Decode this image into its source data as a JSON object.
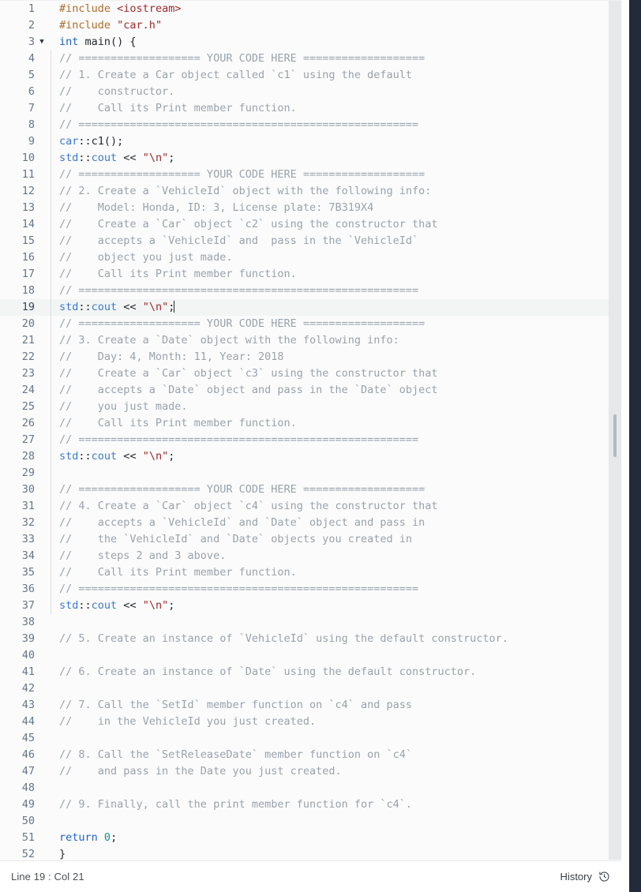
{
  "editor": {
    "language": "cpp",
    "cursor_line": 19,
    "cursor_col": 21,
    "active_line": 19,
    "fold_line": 3,
    "fold_marker": "▼",
    "colors": {
      "background": "#fbfbfb",
      "active_line": "#f2f5f4",
      "gutter_text": "#68758a",
      "comment": "#9aa2ac",
      "keyword": "#1d63c7",
      "namespace": "#3b7ad1",
      "string": "#a0282b",
      "preprocessor": "#b06c28",
      "number": "#12918a",
      "right_rail": "#222a3b",
      "scrollbar_track": "#e6e8ea",
      "scrollbar_thumb": "#b6b9bd"
    },
    "lines": [
      {
        "n": 1,
        "guide": false,
        "tokens": [
          {
            "t": "#include",
            "c": "t-pre"
          },
          {
            "t": " ",
            "c": "t-punc"
          },
          {
            "t": "<iostream>",
            "c": "t-str"
          }
        ]
      },
      {
        "n": 2,
        "guide": false,
        "tokens": [
          {
            "t": "#include",
            "c": "t-pre"
          },
          {
            "t": " ",
            "c": "t-punc"
          },
          {
            "t": "\"car.h\"",
            "c": "t-str"
          }
        ]
      },
      {
        "n": 3,
        "guide": false,
        "fold": true,
        "tokens": [
          {
            "t": "int",
            "c": "t-kw"
          },
          {
            "t": " ",
            "c": "t-punc"
          },
          {
            "t": "main",
            "c": "t-fn"
          },
          {
            "t": "() {",
            "c": "t-punc"
          }
        ]
      },
      {
        "n": 4,
        "guide": true,
        "tokens": [
          {
            "t": "// =================== YOUR CODE HERE ===================",
            "c": "t-cmt"
          }
        ]
      },
      {
        "n": 5,
        "guide": true,
        "tokens": [
          {
            "t": "// 1. Create a Car object called `c1` using the default",
            "c": "t-cmt"
          }
        ]
      },
      {
        "n": 6,
        "guide": true,
        "tokens": [
          {
            "t": "//    constructor.",
            "c": "t-cmt"
          }
        ]
      },
      {
        "n": 7,
        "guide": true,
        "tokens": [
          {
            "t": "//    Call its Print member function.",
            "c": "t-cmt"
          }
        ]
      },
      {
        "n": 8,
        "guide": true,
        "tokens": [
          {
            "t": "// =====================================================",
            "c": "t-cmt"
          }
        ]
      },
      {
        "n": 9,
        "guide": true,
        "tokens": [
          {
            "t": "car",
            "c": "t-ns"
          },
          {
            "t": "::c1();",
            "c": "t-punc"
          }
        ]
      },
      {
        "n": 10,
        "guide": true,
        "tokens": [
          {
            "t": "std",
            "c": "t-ns"
          },
          {
            "t": "::",
            "c": "t-punc"
          },
          {
            "t": "cout",
            "c": "t-ns"
          },
          {
            "t": " << ",
            "c": "t-punc"
          },
          {
            "t": "\"\\n\"",
            "c": "t-str"
          },
          {
            "t": ";",
            "c": "t-punc"
          }
        ]
      },
      {
        "n": 11,
        "guide": true,
        "tokens": [
          {
            "t": "// =================== YOUR CODE HERE ===================",
            "c": "t-cmt"
          }
        ]
      },
      {
        "n": 12,
        "guide": true,
        "tokens": [
          {
            "t": "// 2. Create a `VehicleId` object with the following info:",
            "c": "t-cmt"
          }
        ]
      },
      {
        "n": 13,
        "guide": true,
        "tokens": [
          {
            "t": "//    Model: Honda, ID: 3, License plate: 7B319X4",
            "c": "t-cmt"
          }
        ]
      },
      {
        "n": 14,
        "guide": true,
        "tokens": [
          {
            "t": "//    Create a `Car` object `c2` using the constructor that",
            "c": "t-cmt"
          }
        ]
      },
      {
        "n": 15,
        "guide": true,
        "tokens": [
          {
            "t": "//    accepts a `VehicleId` and  pass in the `VehicleId`",
            "c": "t-cmt"
          }
        ]
      },
      {
        "n": 16,
        "guide": true,
        "tokens": [
          {
            "t": "//    object you just made.",
            "c": "t-cmt"
          }
        ]
      },
      {
        "n": 17,
        "guide": true,
        "tokens": [
          {
            "t": "//    Call its Print member function.",
            "c": "t-cmt"
          }
        ]
      },
      {
        "n": 18,
        "guide": true,
        "tokens": [
          {
            "t": "// =====================================================",
            "c": "t-cmt"
          }
        ]
      },
      {
        "n": 19,
        "guide": true,
        "active": true,
        "caret": true,
        "tokens": [
          {
            "t": "std",
            "c": "t-ns"
          },
          {
            "t": "::",
            "c": "t-punc"
          },
          {
            "t": "cout",
            "c": "t-ns"
          },
          {
            "t": " << ",
            "c": "t-punc"
          },
          {
            "t": "\"\\n\"",
            "c": "t-str"
          },
          {
            "t": ";",
            "c": "t-punc"
          }
        ]
      },
      {
        "n": 20,
        "guide": true,
        "tokens": [
          {
            "t": "// =================== YOUR CODE HERE ===================",
            "c": "t-cmt"
          }
        ]
      },
      {
        "n": 21,
        "guide": true,
        "tokens": [
          {
            "t": "// 3. Create a `Date` object with the following info:",
            "c": "t-cmt"
          }
        ]
      },
      {
        "n": 22,
        "guide": true,
        "tokens": [
          {
            "t": "//    Day: 4, Month: 11, Year: 2018",
            "c": "t-cmt"
          }
        ]
      },
      {
        "n": 23,
        "guide": true,
        "tokens": [
          {
            "t": "//    Create a `Car` object `c3` using the constructor that",
            "c": "t-cmt"
          }
        ]
      },
      {
        "n": 24,
        "guide": true,
        "tokens": [
          {
            "t": "//    accepts a `Date` object and pass in the `Date` object",
            "c": "t-cmt"
          }
        ]
      },
      {
        "n": 25,
        "guide": true,
        "tokens": [
          {
            "t": "//    you just made.",
            "c": "t-cmt"
          }
        ]
      },
      {
        "n": 26,
        "guide": true,
        "tokens": [
          {
            "t": "//    Call its Print member function.",
            "c": "t-cmt"
          }
        ]
      },
      {
        "n": 27,
        "guide": true,
        "tokens": [
          {
            "t": "// =====================================================",
            "c": "t-cmt"
          }
        ]
      },
      {
        "n": 28,
        "guide": true,
        "tokens": [
          {
            "t": "std",
            "c": "t-ns"
          },
          {
            "t": "::",
            "c": "t-punc"
          },
          {
            "t": "cout",
            "c": "t-ns"
          },
          {
            "t": " << ",
            "c": "t-punc"
          },
          {
            "t": "\"\\n\"",
            "c": "t-str"
          },
          {
            "t": ";",
            "c": "t-punc"
          }
        ]
      },
      {
        "n": 29,
        "guide": true,
        "tokens": []
      },
      {
        "n": 30,
        "guide": true,
        "tokens": [
          {
            "t": "// =================== YOUR CODE HERE ===================",
            "c": "t-cmt"
          }
        ]
      },
      {
        "n": 31,
        "guide": true,
        "tokens": [
          {
            "t": "// 4. Create a `Car` object `c4` using the constructor that",
            "c": "t-cmt"
          }
        ]
      },
      {
        "n": 32,
        "guide": true,
        "tokens": [
          {
            "t": "//    accepts a `VehicleId` and `Date` object and pass in",
            "c": "t-cmt"
          }
        ]
      },
      {
        "n": 33,
        "guide": true,
        "tokens": [
          {
            "t": "//    the `VehicleId` and `Date` objects you created in",
            "c": "t-cmt"
          }
        ]
      },
      {
        "n": 34,
        "guide": true,
        "tokens": [
          {
            "t": "//    steps 2 and 3 above.",
            "c": "t-cmt"
          }
        ]
      },
      {
        "n": 35,
        "guide": true,
        "tokens": [
          {
            "t": "//    Call its Print member function.",
            "c": "t-cmt"
          }
        ]
      },
      {
        "n": 36,
        "guide": true,
        "tokens": [
          {
            "t": "// =====================================================",
            "c": "t-cmt"
          }
        ]
      },
      {
        "n": 37,
        "guide": true,
        "tokens": [
          {
            "t": "std",
            "c": "t-ns"
          },
          {
            "t": "::",
            "c": "t-punc"
          },
          {
            "t": "cout",
            "c": "t-ns"
          },
          {
            "t": " << ",
            "c": "t-punc"
          },
          {
            "t": "\"\\n\"",
            "c": "t-str"
          },
          {
            "t": ";",
            "c": "t-punc"
          }
        ]
      },
      {
        "n": 38,
        "guide": false,
        "tokens": []
      },
      {
        "n": 39,
        "guide": false,
        "tokens": [
          {
            "t": "// 5. Create an instance of `VehicleId` using the default constructor.",
            "c": "t-cmt"
          }
        ]
      },
      {
        "n": 40,
        "guide": false,
        "tokens": []
      },
      {
        "n": 41,
        "guide": false,
        "tokens": [
          {
            "t": "// 6. Create an instance of `Date` using the default constructor.",
            "c": "t-cmt"
          }
        ]
      },
      {
        "n": 42,
        "guide": false,
        "tokens": []
      },
      {
        "n": 43,
        "guide": false,
        "tokens": [
          {
            "t": "// 7. Call the `SetId` member function on `c4` and pass",
            "c": "t-cmt"
          }
        ]
      },
      {
        "n": 44,
        "guide": false,
        "tokens": [
          {
            "t": "//    in the VehicleId you just created.",
            "c": "t-cmt"
          }
        ]
      },
      {
        "n": 45,
        "guide": false,
        "tokens": []
      },
      {
        "n": 46,
        "guide": false,
        "tokens": [
          {
            "t": "// 8. Call the `SetReleaseDate` member function on `c4`",
            "c": "t-cmt"
          }
        ]
      },
      {
        "n": 47,
        "guide": false,
        "tokens": [
          {
            "t": "//    and pass in the Date you just created.",
            "c": "t-cmt"
          }
        ]
      },
      {
        "n": 48,
        "guide": false,
        "tokens": []
      },
      {
        "n": 49,
        "guide": false,
        "tokens": [
          {
            "t": "// 9. Finally, call the print member function for `c4`.",
            "c": "t-cmt"
          }
        ]
      },
      {
        "n": 50,
        "guide": false,
        "tokens": []
      },
      {
        "n": 51,
        "guide": false,
        "tokens": [
          {
            "t": "return",
            "c": "t-kw"
          },
          {
            "t": " ",
            "c": "t-punc"
          },
          {
            "t": "0",
            "c": "t-num"
          },
          {
            "t": ";",
            "c": "t-punc"
          }
        ]
      },
      {
        "n": 52,
        "guide": false,
        "tokens": [
          {
            "t": "}",
            "c": "t-punc"
          }
        ]
      }
    ]
  },
  "status_bar": {
    "position": "Line 19 : Col 21",
    "history_label": "History",
    "history_icon": "history-clock-icon"
  }
}
